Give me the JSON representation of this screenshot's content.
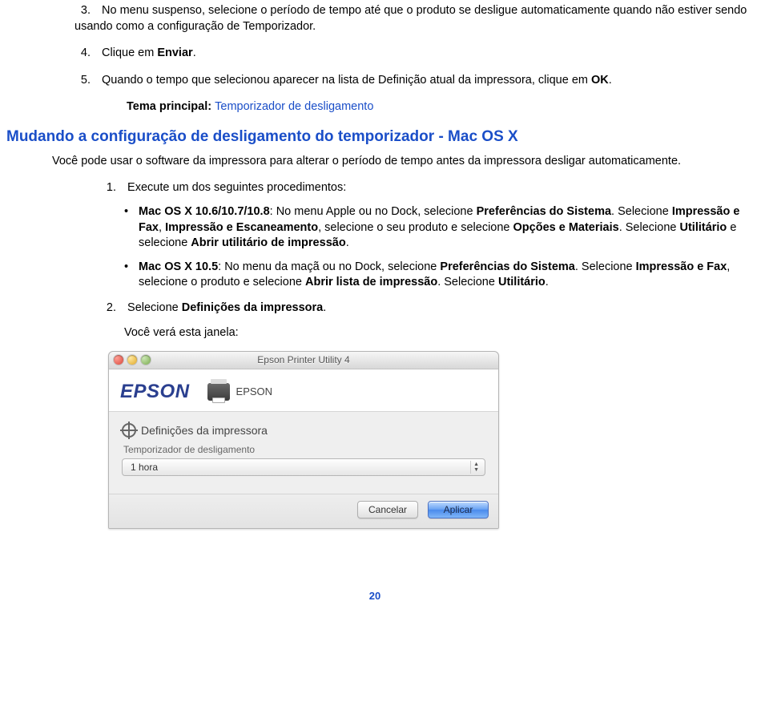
{
  "steps": {
    "s3": {
      "num": "3.",
      "text": "No menu suspenso, selecione o período de tempo até que o produto se desligue automaticamente quando não estiver sendo usando como a configuração de Temporizador."
    },
    "s4": {
      "num": "4.",
      "text_a": "Clique em ",
      "bold": "Enviar",
      "text_b": "."
    },
    "s5": {
      "num": "5.",
      "text_a": "Quando o tempo que selecionou aparecer na lista de Definição atual da impressora, clique em ",
      "bold": "OK",
      "text_b": "."
    }
  },
  "parent_topic": {
    "label": "Tema principal: ",
    "link": "Temporizador de desligamento"
  },
  "heading": "Mudando a configuração de desligamento do temporizador - Mac OS X",
  "intro": "Você pode usar o software da impressora para alterar o período de tempo antes da impressora desligar automaticamente.",
  "sub": {
    "s1": {
      "num": "1.",
      "text": "Execute um dos seguintes procedimentos:"
    },
    "bullet1": {
      "b1": "Mac OS X 10.6/10.7/10.8",
      "t1": ": No menu Apple ou no Dock, selecione ",
      "b2": "Preferências do Sistema",
      "t2": ". Selecione ",
      "b3": "Impressão e Fax",
      "t3": ", ",
      "b4": "Impressão e Escaneamento",
      "t4": ", selecione o seu produto e selecione ",
      "b5": "Opções e Materiais",
      "t5": ". Selecione ",
      "b6": "Utilitário",
      "t6": " e selecione ",
      "b7": "Abrir utilitário de impressão",
      "t7": "."
    },
    "bullet2": {
      "b1": "Mac OS X 10.5",
      "t1": ": No menu da maçã ou no Dock, selecione ",
      "b2": "Preferências do Sistema",
      "t2": ". Selecione ",
      "b3": "Impressão e Fax",
      "t3": ", selecione o produto e selecione ",
      "b4": "Abrir lista de impressão",
      "t4": ". Selecione ",
      "b5": "Utilitário",
      "t5": "."
    },
    "s2": {
      "num": "2.",
      "text_a": "Selecione ",
      "bold": "Definições da impressora",
      "text_b": "."
    },
    "s2b": "Você verá esta janela:"
  },
  "window": {
    "title": "Epson Printer Utility 4",
    "logo": "EPSON",
    "printerName": "EPSON",
    "panelTitle": "Definições da impressora",
    "sectionLabel": "Temporizador de desligamento",
    "selectValue": "1 hora",
    "cancel": "Cancelar",
    "apply": "Aplicar"
  },
  "pageNumber": "20"
}
